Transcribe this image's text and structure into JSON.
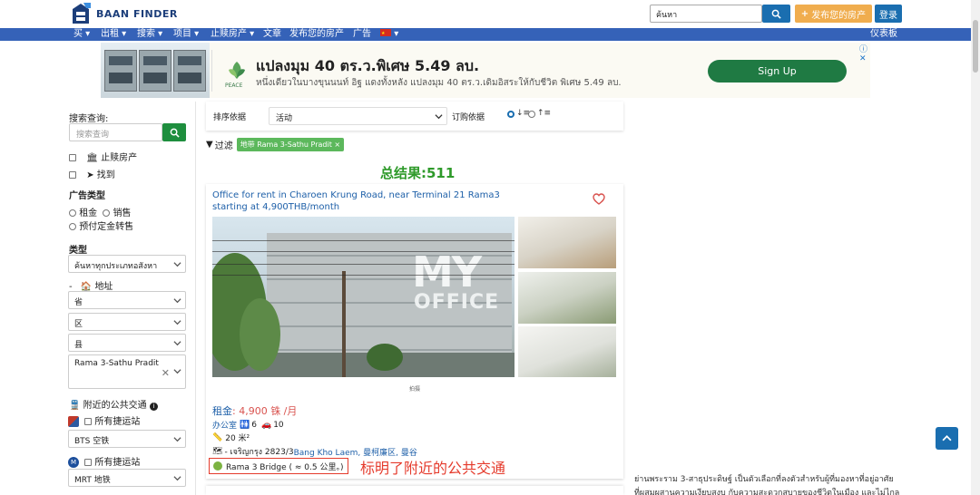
{
  "header": {
    "logo_text": "BAAN FINDER",
    "search_value": "ค้นหา",
    "post_button": "发布您的房产",
    "login_button": "登录"
  },
  "nav": {
    "items": [
      "买 ▾",
      "出租 ▾",
      "搜索 ▾",
      "项目 ▾",
      "止赎房产 ▾",
      "文章",
      "发布您的房产",
      "广告"
    ],
    "lang_arrow": "▾",
    "dashboard": "仪表板"
  },
  "ad": {
    "title": "แปลงมุม 40 ตร.ว.พิเศษ 5.49 ลบ.",
    "subtitle": "หนึ่งเดียวในบางขุนนนท์ อิฐ แดงทั้งหลัง แปลงมุม 40 ตร.ว.เดิมอิสระให้กับชีวิต พิเศษ 5.49 ลบ.",
    "cta": "Sign Up",
    "brand": "PEACE",
    "info_marks": "ⓘ ✕"
  },
  "sidebar": {
    "search_label": "搜索查询:",
    "search_placeholder": "搜索查询",
    "foreclosure": "止赎房产",
    "find": "找到",
    "ad_type_title": "广告类型",
    "rent": "租金",
    "sale": "销售",
    "presale": "预付定金转售",
    "type_title": "类型",
    "type_value": "ค้นหาทุกประเภทอสังหา",
    "address_title": "地址",
    "address_dash": "-",
    "province": "省",
    "district": "区",
    "subdistrict": "县",
    "location_value": "Rama 3-Sathu Pradit",
    "transit_title": "附近的公共交通",
    "all_bts": "所有捷运站",
    "bts_value": "BTS 空铁",
    "all_mrt": "所有捷运站",
    "mrt_value": "MRT 地铁"
  },
  "content": {
    "sort_label": "排序依据",
    "sort_value": "活动",
    "order_label": "订购依据",
    "filter_label": "过滤",
    "filter_tag": "地带 Rama 3-Sathu Pradit ×",
    "total": "总结果:511"
  },
  "listing": {
    "title": "Office for rent in Charoen Krung Road, near Terminal 21 Rama3 starting at 4,900THB/month",
    "sign_line1": "MY",
    "sign_line2": "OFFICE",
    "caption": "拍摄",
    "price_label": "租金",
    "price_value": ": 4,900 铢 /月",
    "type": "办公室",
    "bathrooms": "6",
    "parking": "10",
    "area": "20 米²",
    "address_prefix": "- เจริญกรุง 2823/3 ",
    "address_links": "Bang Kho Laem, 曼柯廉区, 曼谷",
    "transit": "Rama 3 Bridge ( ≈ 0.5 公里。)",
    "annotation": "标明了附近的公共交通"
  },
  "right_column": {
    "line1": "ย่านพระราม 3-สาธุประดิษฐ์ เป็นตัวเลือกที่ลงตัวสำหรับผู้ที่มองหาที่อยู่อาศัย",
    "line2": "ที่ผสมผสานความเงียบสงบ กับความสะดวกสบายของชีวิตในเมือง และไม่ไกล"
  },
  "colors": {
    "brand_blue": "#1a6eb0",
    "nav_blue": "#3562b8",
    "green": "#2e9a2a",
    "annotation_red": "#e53b2c"
  }
}
